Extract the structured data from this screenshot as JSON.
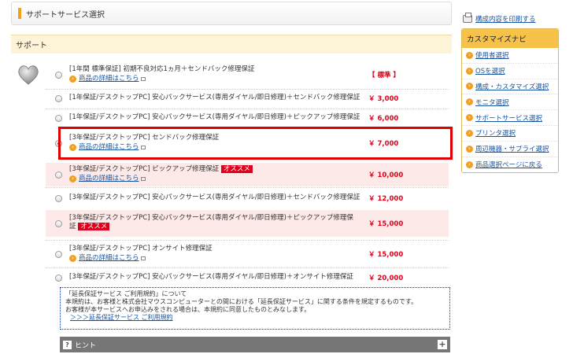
{
  "header": {
    "title": "サポートサービス選択"
  },
  "support_section": {
    "label": "サポート"
  },
  "options": [
    {
      "label": "[1年間 標準保証] 初期不良対応1ヵ月＋センドバック修理保証",
      "link": "商品の詳細はこちら",
      "price": "【 標準 】",
      "selected": false
    },
    {
      "label": "[1年保証/デスクトップPC] 安心パックサービス(専用ダイヤル/即日修理)＋センドバック修理保証",
      "link": "",
      "price": "￥ 3,000",
      "selected": false
    },
    {
      "label": "[1年保証/デスクトップPC] 安心パックサービス(専用ダイヤル/即日修理)＋ピックアップ修理保証",
      "link": "",
      "price": "￥ 6,000",
      "selected": false
    },
    {
      "label": "[3年保証/デスクトップPC] センドバック修理保証",
      "link": "商品の詳細はこちら",
      "price": "￥ 7,000",
      "selected": true
    },
    {
      "label": "[3年保証/デスクトップPC] ピックアップ修理保証",
      "badge": "オススメ",
      "link": "商品の詳細はこちら",
      "price": "￥ 10,000",
      "selected": false
    },
    {
      "label": "[3年保証/デスクトップPC] 安心パックサービス(専用ダイヤル/即日修理)＋センドバック修理保証",
      "link": "",
      "price": "￥ 12,000",
      "selected": false
    },
    {
      "label_line1": "[3年保証/デスクトップPC] 安心パックサービス(専用ダイヤル/即日修理)＋ピックアップ修理保",
      "label_line2": "証",
      "badge": "オススメ",
      "price": "￥ 15,000",
      "selected": false
    },
    {
      "label": "[3年保証/デスクトップPC] オンサイト修理保証",
      "link": "商品の詳細はこちら",
      "price": "￥ 15,000",
      "selected": false
    },
    {
      "label": "[3年保証/デスクトップPC] 安心パックサービス(専用ダイヤル/即日修理)＋オンサイト修理保証",
      "link": "",
      "price": "￥ 20,000",
      "selected": false
    }
  ],
  "terms": {
    "title": "「延長保証サービス ご利用規約」について",
    "line1": "本規約は、お客様と株式会社マウスコンピューターとの間における「延長保証サービス」に関する条件を規定するものです。",
    "line2": "お客様が本サービスへお申込みをされる場合は、本規約に同意したものとみなします。",
    "link": "＞＞＞延長保証サービス ご利用規約"
  },
  "hint": {
    "label": "ヒント",
    "q_icon": "?",
    "plus": "+"
  },
  "print_link": "構成内容を印刷する",
  "nav": {
    "title": "カスタマイズナビ",
    "items": [
      "使用者選択",
      "OSを選択",
      "構成・カスタマイズ選択",
      "モニタ選択",
      "サポートサービス選択",
      "プリンタ選択",
      "周辺機器・サプライ選択",
      "商品選択ページに戻る"
    ]
  },
  "icons": {
    "arrow": "›"
  },
  "colors": {
    "accent": "#f0a020",
    "price": "#e0001b",
    "highlight": "#e10000",
    "link": "#1a55a0"
  }
}
